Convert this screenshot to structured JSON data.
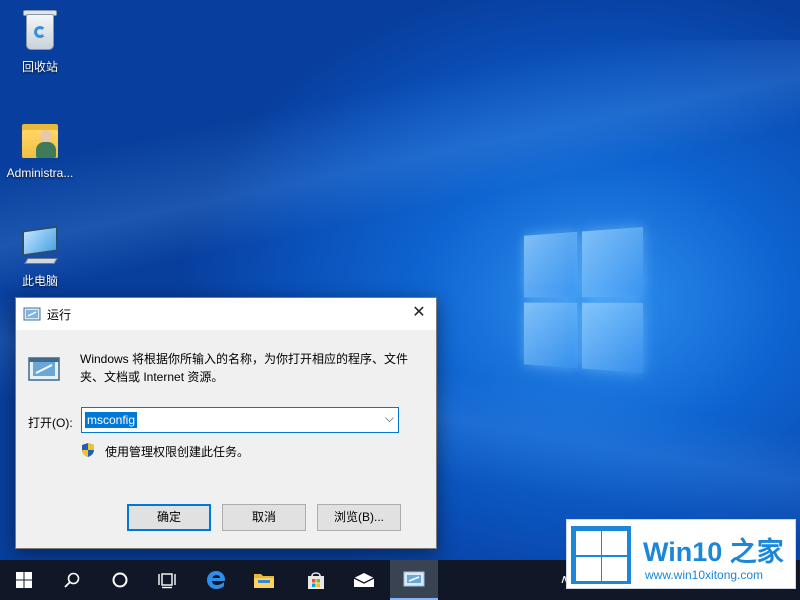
{
  "desktop": {
    "icons": [
      {
        "label": "回收站",
        "icon": "recycle-bin-icon"
      },
      {
        "label": "Administra...",
        "icon": "user-folder-icon"
      },
      {
        "label": "此电脑",
        "icon": "this-pc-icon"
      }
    ]
  },
  "run_dialog": {
    "title": "运行",
    "close_glyph": "✕",
    "description": "Windows 将根据你所输入的名称，为你打开相应的程序、文件夹、文档或 Internet 资源。",
    "open_label": "打开(O):",
    "input_value": "msconfig",
    "dropdown_glyph": "⌵",
    "admin_note": "使用管理权限创建此任务。",
    "buttons": {
      "ok": "确定",
      "cancel": "取消",
      "browse": "浏览(B)..."
    }
  },
  "taskbar": {
    "items": [
      {
        "name": "start",
        "icon": "windows-start-icon"
      },
      {
        "name": "search",
        "icon": "search-icon"
      },
      {
        "name": "cortana",
        "icon": "cortana-circle-icon"
      },
      {
        "name": "task-view",
        "icon": "task-view-icon"
      },
      {
        "name": "edge",
        "icon": "edge-browser-icon"
      },
      {
        "name": "file-explorer",
        "icon": "folder-icon"
      },
      {
        "name": "store",
        "icon": "store-bag-icon"
      },
      {
        "name": "mail",
        "icon": "mail-icon"
      },
      {
        "name": "run",
        "icon": "run-icon",
        "active": true
      }
    ],
    "tray_glyph": "∧"
  },
  "watermark": {
    "brand": "Win10 之家",
    "url": "www.win10xitong.com"
  },
  "colors": {
    "accent": "#0078d7",
    "desktop": "#0e63cf",
    "taskbar": "#101827",
    "watermark_blue": "#1c86d8"
  }
}
